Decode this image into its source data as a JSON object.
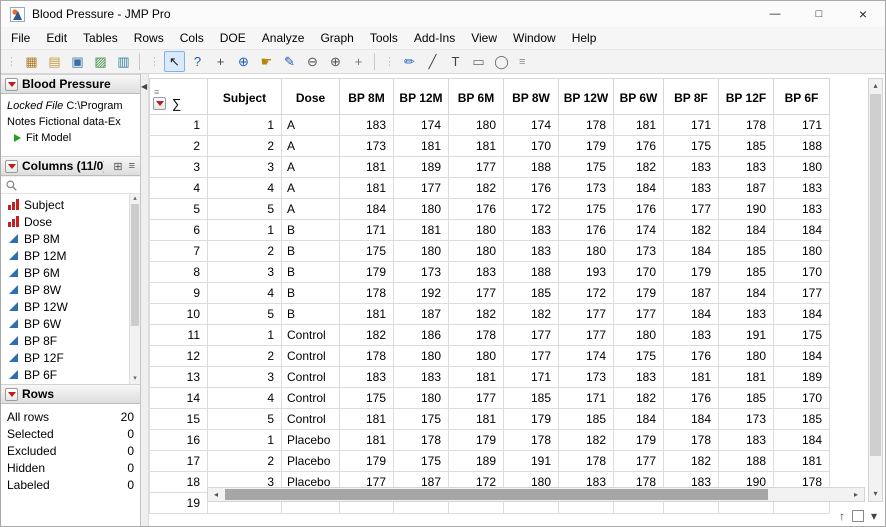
{
  "window": {
    "title": "Blood Pressure - JMP Pro"
  },
  "titlebar": {
    "minimize": "—",
    "maximize": "□",
    "close": "×"
  },
  "menu": {
    "items": [
      "File",
      "Edit",
      "Tables",
      "Rows",
      "Cols",
      "DOE",
      "Analyze",
      "Graph",
      "Tools",
      "Add-Ins",
      "View",
      "Window",
      "Help"
    ]
  },
  "toolbar": {
    "groups": [
      [
        {
          "name": "new-data-table-icon",
          "glyph": "▦",
          "color": "#b07a2a"
        },
        {
          "name": "open-file-icon",
          "glyph": "▤",
          "color": "#c79a3e"
        },
        {
          "name": "save-icon",
          "glyph": "▣",
          "color": "#3a6ea5"
        },
        {
          "name": "new-journal-icon",
          "glyph": "▨",
          "color": "#3f8f3f"
        },
        {
          "name": "layout-icon",
          "glyph": "▥",
          "color": "#2e7d9e"
        }
      ],
      [
        {
          "name": "arrow-tool-icon",
          "glyph": "↖",
          "color": "#1b1b1b",
          "selected": true
        },
        {
          "name": "help-tool-icon",
          "glyph": "?",
          "color": "#1a5fb4"
        },
        {
          "name": "crosshair-tool-icon",
          "glyph": "+",
          "color": "#444444"
        },
        {
          "name": "grabber-tool-icon",
          "glyph": "⊕",
          "color": "#1a5fb4"
        },
        {
          "name": "hand-tool-icon",
          "glyph": "☛",
          "color": "#b8860b"
        },
        {
          "name": "brush-tool-icon",
          "glyph": "✎",
          "color": "#1a5fb4"
        },
        {
          "name": "zoom-out-tool-icon",
          "glyph": "⊖",
          "color": "#555555"
        },
        {
          "name": "zoom-in-tool-icon",
          "glyph": "⊕",
          "color": "#555555"
        },
        {
          "name": "selection-plus-tool-icon",
          "glyph": "+",
          "color": "#777777"
        }
      ],
      [
        {
          "name": "annotate-pencil-icon",
          "glyph": "✏",
          "color": "#1a5fb4"
        },
        {
          "name": "line-annotate-icon",
          "glyph": "╱",
          "color": "#444444"
        },
        {
          "name": "text-annotate-icon",
          "glyph": "T",
          "color": "#444444"
        },
        {
          "name": "rect-annotate-icon",
          "glyph": "▭",
          "color": "#666666"
        },
        {
          "name": "oval-annotate-icon",
          "glyph": "◯",
          "color": "#666666"
        }
      ]
    ]
  },
  "sidebar": {
    "table_panel": {
      "title": "Blood Pressure",
      "properties": [
        {
          "label": "Locked File",
          "value": "C:\\Program",
          "italic": true
        },
        {
          "label": "Notes",
          "value": "Fictional data-Ex",
          "italic": false
        }
      ],
      "script_label": "Fit Model"
    },
    "columns_panel": {
      "title": "Columns (11/0)",
      "view_icon": "⊞",
      "menu_icon": "≡",
      "items": [
        {
          "name": "Subject",
          "type": "nominal"
        },
        {
          "name": "Dose",
          "type": "nominal"
        },
        {
          "name": "BP 8M",
          "type": "continuous"
        },
        {
          "name": "BP 12M",
          "type": "continuous"
        },
        {
          "name": "BP 6M",
          "type": "continuous"
        },
        {
          "name": "BP 8W",
          "type": "continuous"
        },
        {
          "name": "BP 12W",
          "type": "continuous"
        },
        {
          "name": "BP 6W",
          "type": "continuous"
        },
        {
          "name": "BP 8F",
          "type": "continuous"
        },
        {
          "name": "BP 12F",
          "type": "continuous"
        },
        {
          "name": "BP 6F",
          "type": "continuous"
        }
      ]
    },
    "rows_panel": {
      "title": "Rows",
      "stats": [
        {
          "label": "All rows",
          "value": "20"
        },
        {
          "label": "Selected",
          "value": "0"
        },
        {
          "label": "Excluded",
          "value": "0"
        },
        {
          "label": "Hidden",
          "value": "0"
        },
        {
          "label": "Labeled",
          "value": "0"
        }
      ]
    }
  },
  "table": {
    "corner_sigma": "∑",
    "columns": [
      "Subject",
      "Dose",
      "BP 8M",
      "BP 12M",
      "BP 6M",
      "BP 8W",
      "BP 12W",
      "BP 6W",
      "BP 8F",
      "BP 12F",
      "BP 6F"
    ],
    "rows": [
      [
        "1",
        "1",
        "A",
        "183",
        "174",
        "180",
        "174",
        "178",
        "181",
        "171",
        "178",
        "171"
      ],
      [
        "2",
        "2",
        "A",
        "173",
        "181",
        "181",
        "170",
        "179",
        "176",
        "175",
        "185",
        "188"
      ],
      [
        "3",
        "3",
        "A",
        "181",
        "189",
        "177",
        "188",
        "175",
        "182",
        "183",
        "183",
        "180"
      ],
      [
        "4",
        "4",
        "A",
        "181",
        "177",
        "182",
        "176",
        "173",
        "184",
        "183",
        "187",
        "183"
      ],
      [
        "5",
        "5",
        "A",
        "184",
        "180",
        "176",
        "172",
        "175",
        "176",
        "177",
        "190",
        "183"
      ],
      [
        "6",
        "1",
        "B",
        "171",
        "181",
        "180",
        "183",
        "176",
        "174",
        "182",
        "184",
        "184"
      ],
      [
        "7",
        "2",
        "B",
        "175",
        "180",
        "180",
        "183",
        "180",
        "173",
        "184",
        "185",
        "180"
      ],
      [
        "8",
        "3",
        "B",
        "179",
        "173",
        "183",
        "188",
        "193",
        "170",
        "179",
        "185",
        "170"
      ],
      [
        "9",
        "4",
        "B",
        "178",
        "192",
        "177",
        "185",
        "172",
        "179",
        "187",
        "184",
        "177"
      ],
      [
        "10",
        "5",
        "B",
        "181",
        "187",
        "182",
        "182",
        "177",
        "177",
        "184",
        "183",
        "184"
      ],
      [
        "11",
        "1",
        "Control",
        "182",
        "186",
        "178",
        "177",
        "177",
        "180",
        "183",
        "191",
        "175"
      ],
      [
        "12",
        "2",
        "Control",
        "178",
        "180",
        "180",
        "177",
        "174",
        "175",
        "176",
        "180",
        "184"
      ],
      [
        "13",
        "3",
        "Control",
        "183",
        "183",
        "181",
        "171",
        "173",
        "183",
        "181",
        "181",
        "189"
      ],
      [
        "14",
        "4",
        "Control",
        "175",
        "180",
        "177",
        "185",
        "171",
        "182",
        "176",
        "185",
        "170"
      ],
      [
        "15",
        "5",
        "Control",
        "181",
        "175",
        "181",
        "179",
        "185",
        "184",
        "184",
        "173",
        "185"
      ],
      [
        "16",
        "1",
        "Placebo",
        "181",
        "178",
        "179",
        "178",
        "182",
        "179",
        "178",
        "183",
        "184"
      ],
      [
        "17",
        "2",
        "Placebo",
        "179",
        "175",
        "189",
        "191",
        "178",
        "177",
        "182",
        "188",
        "181"
      ],
      [
        "18",
        "3",
        "Placebo",
        "177",
        "187",
        "172",
        "180",
        "183",
        "178",
        "183",
        "190",
        "178"
      ],
      [
        "19",
        "",
        "",
        "",
        "",
        "",
        "",
        "",
        "",
        "",
        "",
        ""
      ]
    ]
  },
  "icons": {
    "collapse": "◀",
    "hscroll_left": "◂",
    "hscroll_right": "▸",
    "vscroll_up": "▴",
    "vscroll_down": "▾",
    "list_up": "▴",
    "list_down": "▾",
    "corner_filter": "≡"
  },
  "status": {
    "scroll_top": "↑",
    "dropdown": "▾"
  }
}
